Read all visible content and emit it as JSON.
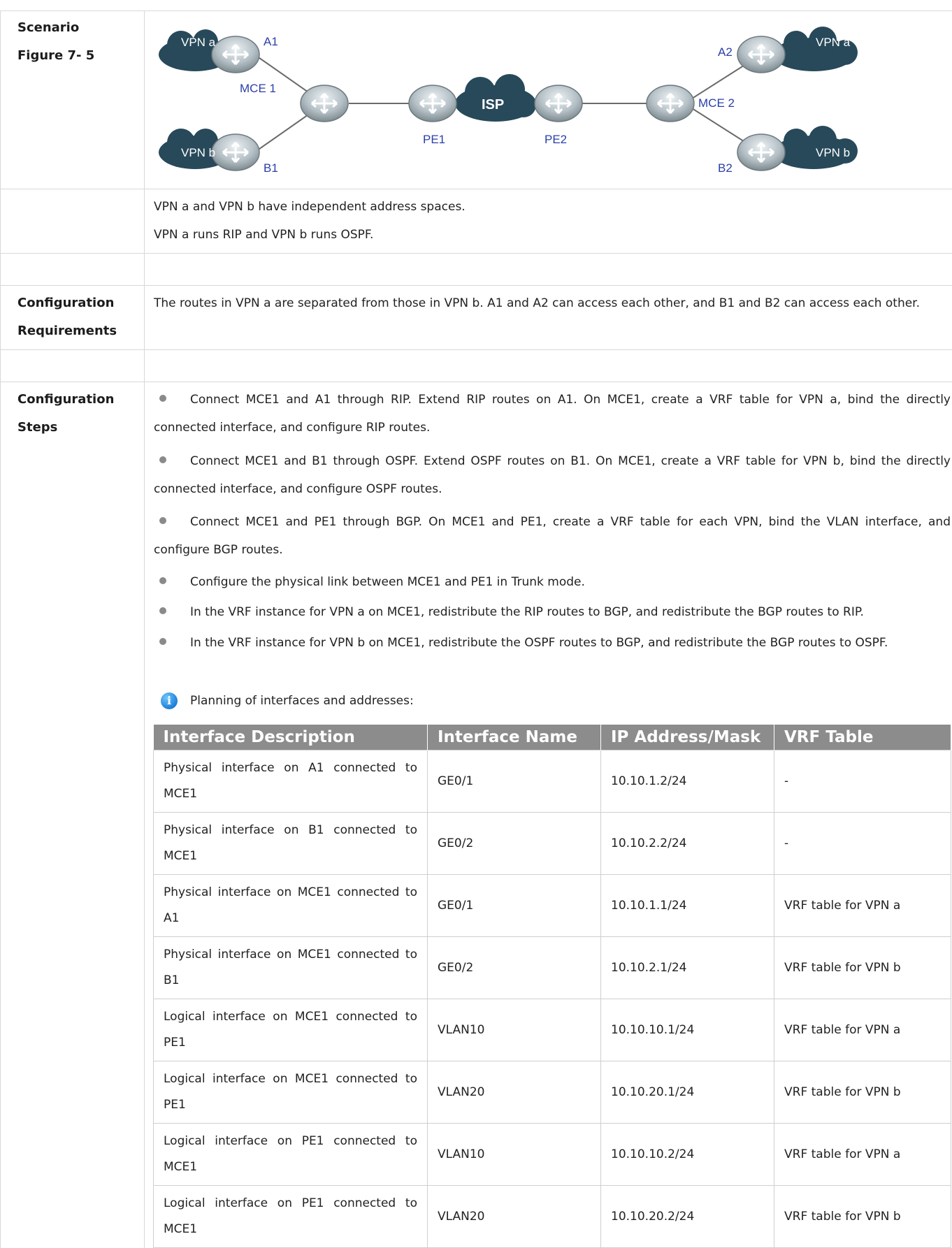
{
  "labels": {
    "scenario": "Scenario",
    "figure": "Figure 7- 5",
    "config_requirements_1": "Configuration",
    "config_requirements_2": "Requirements",
    "config_steps_1": "Configuration",
    "config_steps_2": "Steps"
  },
  "diagram": {
    "vpn_a_left": "VPN a",
    "vpn_b_left": "VPN b",
    "vpn_a_right": "VPN a",
    "vpn_b_right": "VPN b",
    "a1": "A1",
    "b1": "B1",
    "a2": "A2",
    "b2": "B2",
    "mce1": "MCE 1",
    "mce2": "MCE 2",
    "pe1": "PE1",
    "pe2": "PE2",
    "isp": "ISP"
  },
  "description": {
    "line1": "VPN a and VPN b have independent address spaces.",
    "line2": "VPN a runs RIP and VPN b runs OSPF."
  },
  "requirements": {
    "text": "The routes in VPN a are separated from those in VPN b. A1 and A2 can access each other, and B1 and B2 can access each other."
  },
  "steps": [
    "Connect MCE1 and A1 through RIP. Extend RIP routes on A1. On MCE1, create a VRF table for VPN a, bind the directly connected interface, and configure RIP routes.",
    "Connect MCE1 and B1 through OSPF. Extend OSPF routes on B1. On MCE1, create a VRF table for VPN b, bind the directly connected interface, and configure OSPF routes.",
    "Connect MCE1 and PE1 through BGP. On MCE1 and PE1, create a VRF table for each VPN, bind the VLAN interface, and configure BGP routes.",
    "Configure the physical link between MCE1 and PE1 in Trunk mode.",
    "In the VRF instance for VPN a on MCE1, redistribute the RIP routes to BGP, and redistribute the BGP routes to RIP.",
    "In the VRF instance for VPN b on MCE1, redistribute the OSPF routes to BGP, and redistribute the BGP routes to OSPF."
  ],
  "note": "Planning of interfaces and addresses:",
  "table": {
    "headers": [
      "Interface Description",
      "Interface Name",
      "IP Address/Mask",
      "VRF Table"
    ],
    "rows": [
      [
        "Physical interface on A1 connected to MCE1",
        "GE0/1",
        "10.10.1.2/24",
        "-"
      ],
      [
        "Physical interface on B1 connected to MCE1",
        "GE0/2",
        "10.10.2.2/24",
        "-"
      ],
      [
        "Physical interface on MCE1 connected to A1",
        "GE0/1",
        "10.10.1.1/24",
        "VRF table for VPN a"
      ],
      [
        "Physical interface on MCE1 connected to B1",
        "GE0/2",
        "10.10.2.1/24",
        "VRF table for VPN b"
      ],
      [
        "Logical interface on MCE1 connected to PE1",
        "VLAN10",
        "10.10.10.1/24",
        "VRF table for VPN a"
      ],
      [
        "Logical interface on MCE1 connected to PE1",
        "VLAN20",
        "10.10.20.1/24",
        "VRF table for VPN b"
      ],
      [
        "Logical interface on PE1 connected to MCE1",
        "VLAN10",
        "10.10.10.2/24",
        "VRF table for VPN a"
      ],
      [
        "Logical interface on PE1 connected to MCE1",
        "VLAN20",
        "10.10.20.2/24",
        "VRF table for VPN b"
      ]
    ]
  }
}
